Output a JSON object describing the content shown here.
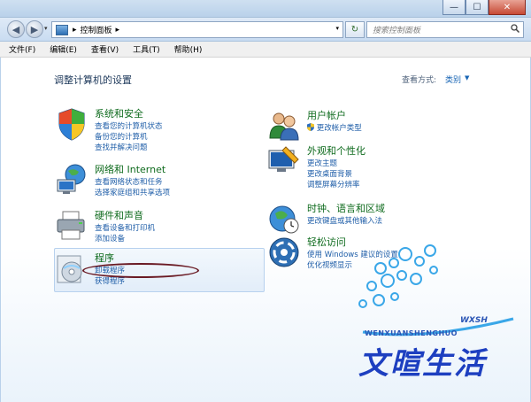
{
  "window": {
    "minimize": "—",
    "maximize": "☐",
    "close": "✕"
  },
  "addressbar": {
    "crumb_root": "▸",
    "crumb": "控制面板",
    "crumb_sep": "▸",
    "dropdown": "▾",
    "refresh": "↻",
    "search_placeholder": "搜索控制面板",
    "back": "◀",
    "forward": "▶"
  },
  "menu": [
    "文件(F)",
    "编辑(E)",
    "查看(V)",
    "工具(T)",
    "帮助(H)"
  ],
  "page": {
    "title": "调整计算机的设置",
    "view_label": "查看方式:",
    "view_value": "类别",
    "view_arrow": "▼"
  },
  "left_categories": [
    {
      "title": "系统和安全",
      "links": [
        "查看您的计算机状态",
        "备份您的计算机",
        "查找并解决问题"
      ]
    },
    {
      "title": "网络和 Internet",
      "links": [
        "查看网络状态和任务",
        "选择家庭组和共享选项"
      ]
    },
    {
      "title": "硬件和声音",
      "links": [
        "查看设备和打印机",
        "添加设备"
      ]
    },
    {
      "title": "程序",
      "links": [
        "卸载程序",
        "获得程序"
      ]
    }
  ],
  "right_categories": [
    {
      "title": "用户帐户",
      "links": [
        "更改帐户类型"
      ]
    },
    {
      "title": "外观和个性化",
      "links": [
        "更改主题",
        "更改桌面背景",
        "调整屏幕分辨率"
      ]
    },
    {
      "title": "时钟、语言和区域",
      "links": [
        "更改键盘或其他输入法"
      ]
    },
    {
      "title": "轻松访问",
      "links": [
        "使用 Windows 建议的设置",
        "优化视频显示"
      ]
    }
  ],
  "watermark": {
    "en": "WENXUANSHENGHUO",
    "cn": "文暄生活",
    "sub": "WXSH"
  }
}
